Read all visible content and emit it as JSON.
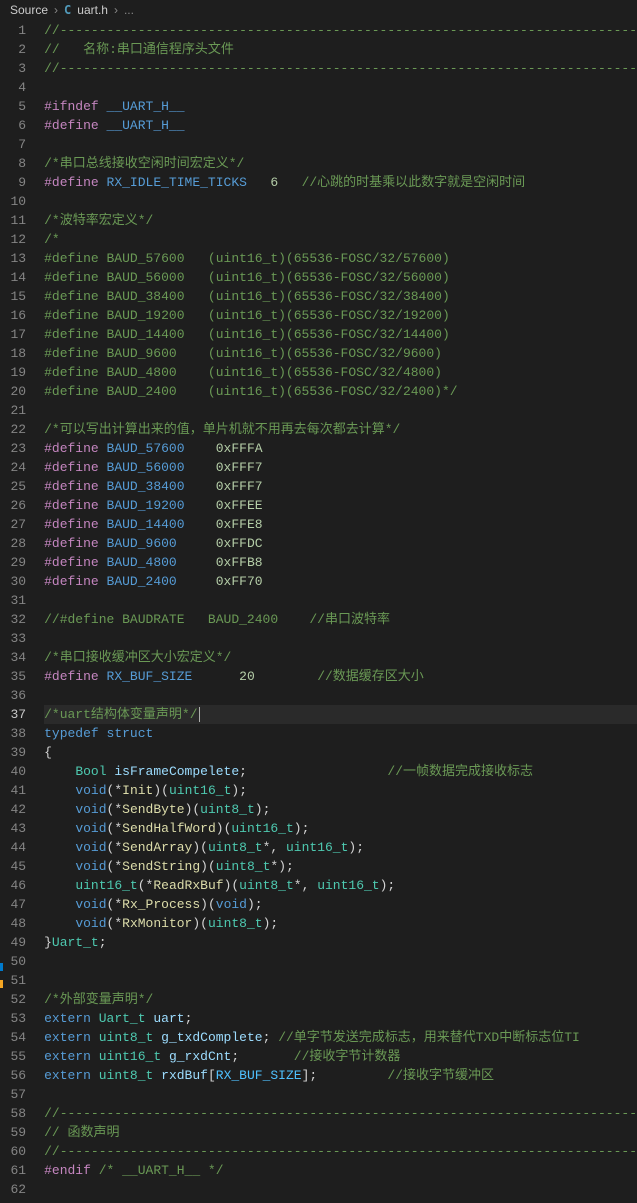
{
  "breadcrumb": {
    "folder": "Source",
    "filename": "uart.h",
    "more": "..."
  },
  "lineCount": 62,
  "currentLine": 37,
  "code": {
    "l1": {
      "comment": "//--------------------------------------------------------------------------"
    },
    "l2": {
      "comment_pre": "//   ",
      "comment_text": "名称:串口通信程序头文件"
    },
    "l3": {
      "comment": "//--------------------------------------------------------------------------"
    },
    "l5": {
      "dir": "#ifndef",
      "macro": "__UART_H__"
    },
    "l6": {
      "dir": "#define",
      "macro": "__UART_H__"
    },
    "l8": {
      "comment": "/*串口总线接收空闲时间宏定义*/"
    },
    "l9": {
      "dir": "#define",
      "macro": "RX_IDLE_TIME_TICKS",
      "val": "6",
      "comment": "//心跳的时基乘以此数字就是空闲时间"
    },
    "l11": {
      "comment": "/*波特率宏定义*/"
    },
    "l12": {
      "comment": "/*"
    },
    "l13": {
      "dir": "#define",
      "mname": "BAUD_57600",
      "cast": "(uint16_t)",
      "expr": "(65536-FOSC/32/57600)"
    },
    "l14": {
      "dir": "#define",
      "mname": "BAUD_56000",
      "cast": "(uint16_t)",
      "expr": "(65536-FOSC/32/56000)"
    },
    "l15": {
      "dir": "#define",
      "mname": "BAUD_38400",
      "cast": "(uint16_t)",
      "expr": "(65536-FOSC/32/38400)"
    },
    "l16": {
      "dir": "#define",
      "mname": "BAUD_19200",
      "cast": "(uint16_t)",
      "expr": "(65536-FOSC/32/19200)"
    },
    "l17": {
      "dir": "#define",
      "mname": "BAUD_14400",
      "cast": "(uint16_t)",
      "expr": "(65536-FOSC/32/14400)"
    },
    "l18": {
      "dir": "#define",
      "mname": "BAUD_9600",
      "cast": "(uint16_t)",
      "expr": "(65536-FOSC/32/9600)"
    },
    "l19": {
      "dir": "#define",
      "mname": "BAUD_4800",
      "cast": "(uint16_t)",
      "expr": "(65536-FOSC/32/4800)"
    },
    "l20": {
      "dir": "#define",
      "mname": "BAUD_2400",
      "cast": "(uint16_t)",
      "expr": "(65536-FOSC/32/2400)*/"
    },
    "l22": {
      "comment": "/*可以写出计算出来的值，单片机就不用再去每次都去计算*/"
    },
    "l23": {
      "dir": "#define",
      "mname": "BAUD_57600",
      "hex": "0xFFFA"
    },
    "l24": {
      "dir": "#define",
      "mname": "BAUD_56000",
      "hex": "0xFFF7"
    },
    "l25": {
      "dir": "#define",
      "mname": "BAUD_38400",
      "hex": "0xFFF7"
    },
    "l26": {
      "dir": "#define",
      "mname": "BAUD_19200",
      "hex": "0xFFEE"
    },
    "l27": {
      "dir": "#define",
      "mname": "BAUD_14400",
      "hex": "0xFFE8"
    },
    "l28": {
      "dir": "#define",
      "mname": "BAUD_9600",
      "hex": "0xFFDC"
    },
    "l29": {
      "dir": "#define",
      "mname": "BAUD_4800",
      "hex": "0xFFB8"
    },
    "l30": {
      "dir": "#define",
      "mname": "BAUD_2400",
      "hex": "0xFF70"
    },
    "l32": {
      "comment": "//#define BAUDRATE   BAUD_2400    //串口波特率"
    },
    "l34": {
      "comment": "/*串口接收缓冲区大小宏定义*/"
    },
    "l35": {
      "dir": "#define",
      "macro": "RX_BUF_SIZE",
      "val": "20",
      "comment": "//数据缓存区大小"
    },
    "l37": {
      "comment": "/*uart结构体变量声明*/"
    },
    "l38": {
      "kw": "typedef",
      "kw2": "struct"
    },
    "l39": {
      "brace": "{"
    },
    "l40": {
      "type": "Bool",
      "var": "isFrameCompelete",
      "comment": "//一帧数据完成接收标志"
    },
    "l41": {
      "ret": "void",
      "fn": "Init",
      "arg": "uint16_t"
    },
    "l42": {
      "ret": "void",
      "fn": "SendByte",
      "arg": "uint8_t"
    },
    "l43": {
      "ret": "void",
      "fn": "SendHalfWord",
      "arg": "uint16_t"
    },
    "l44": {
      "ret": "void",
      "fn": "SendArray",
      "arg1": "uint8_t",
      "arg2": "uint16_t"
    },
    "l45": {
      "ret": "void",
      "fn": "SendString",
      "arg1": "uint8_t"
    },
    "l46": {
      "ret": "uint16_t",
      "fn": "ReadRxBuf",
      "arg1": "uint8_t",
      "arg2": "uint16_t"
    },
    "l47": {
      "ret": "void",
      "fn": "Rx_Process",
      "arg": "void"
    },
    "l48": {
      "ret": "void",
      "fn": "RxMonitor",
      "arg": "uint8_t"
    },
    "l49": {
      "brace": "}",
      "type": "Uart_t"
    },
    "l52": {
      "comment": "/*外部变量声明*/"
    },
    "l53": {
      "kw": "extern",
      "type": "Uart_t",
      "var": "uart"
    },
    "l54": {
      "kw": "extern",
      "type": "uint8_t",
      "var": "g_txdComplete",
      "comment": "//单字节发送完成标志，用来替代TXD中断标志位TI"
    },
    "l55": {
      "kw": "extern",
      "type": "uint16_t",
      "var": "g_rxdCnt",
      "comment": "//接收字节计数器"
    },
    "l56": {
      "kw": "extern",
      "type": "uint8_t",
      "var": "rxdBuf",
      "idx": "RX_BUF_SIZE",
      "comment": "//接收字节缓冲区"
    },
    "l58": {
      "comment": "//--------------------------------------------------------------------------"
    },
    "l59": {
      "comment": "// 函数声明"
    },
    "l60": {
      "comment": "//--------------------------------------------------------------------------"
    },
    "l61": {
      "dir": "#endif",
      "comment": "/* __UART_H__ */"
    }
  }
}
